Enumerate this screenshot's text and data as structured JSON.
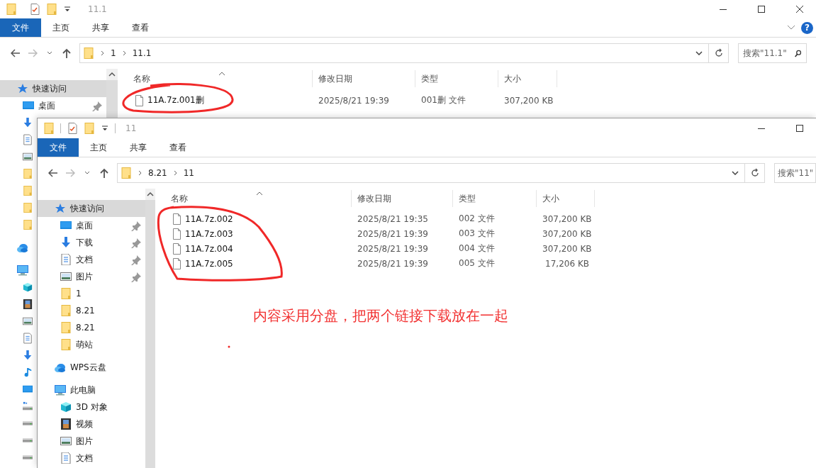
{
  "windows": [
    {
      "title": "11.1",
      "help": "?",
      "tabs": [
        {
          "label": "文件",
          "kind": "file"
        },
        {
          "label": "主页",
          "kind": "tab"
        },
        {
          "label": "共享",
          "kind": "tab"
        },
        {
          "label": "查看",
          "kind": "tab"
        }
      ],
      "path": [
        "1",
        "11.1"
      ],
      "search": {
        "placeholder": "搜索\"11.1\""
      },
      "nav": [
        {
          "label": "快速访问",
          "kind": "star",
          "selected": true,
          "children": [
            {
              "label": "桌面",
              "kind": "desktop",
              "selected": false,
              "pinned": true
            },
            {
              "kind": "download",
              "selected": false,
              "pinned": false
            },
            {
              "kind": "documents",
              "selected": false,
              "pinned": false
            },
            {
              "kind": "pictures",
              "selected": false,
              "pinned": false
            },
            {
              "kind": "folder",
              "selected": false,
              "pinned": false
            },
            {
              "kind": "folder",
              "selected": false,
              "pinned": false
            },
            {
              "kind": "folder",
              "selected": false,
              "pinned": false
            },
            {
              "kind": "folder",
              "selected": false,
              "pinned": false
            }
          ]
        },
        {
          "kind": "cloud",
          "selected": false
        },
        {
          "kind": "pc",
          "selected": false,
          "children": [
            {
              "kind": "cube",
              "selected": false,
              "pinned": false
            },
            {
              "kind": "video",
              "selected": false,
              "pinned": false
            },
            {
              "kind": "pictures",
              "selected": false,
              "pinned": false
            },
            {
              "kind": "documents",
              "selected": false,
              "pinned": false
            },
            {
              "kind": "download",
              "selected": false,
              "pinned": false
            },
            {
              "kind": "music",
              "selected": false,
              "pinned": false
            },
            {
              "kind": "desktop",
              "selected": false,
              "pinned": false
            },
            {
              "kind": "netdrive",
              "selected": false,
              "pinned": false
            },
            {
              "kind": "drive",
              "selected": false,
              "pinned": false
            },
            {
              "kind": "drive",
              "selected": false,
              "pinned": false
            },
            {
              "kind": "drive",
              "selected": false,
              "pinned": false
            }
          ]
        }
      ],
      "columns": [
        "名称",
        "修改日期",
        "类型",
        "大小"
      ],
      "files": [
        {
          "name": "11A.7z.001删",
          "modified": "2025/8/21 19:39",
          "type": "001删 文件",
          "size": "307,200 KB"
        }
      ]
    },
    {
      "title": "11",
      "tabs": [
        {
          "label": "文件",
          "kind": "file"
        },
        {
          "label": "主页",
          "kind": "tab"
        },
        {
          "label": "共享",
          "kind": "tab"
        },
        {
          "label": "查看",
          "kind": "tab"
        }
      ],
      "path": [
        "8.21",
        "11"
      ],
      "search": {
        "placeholder": "搜索\"11\""
      },
      "nav": [
        {
          "label": "快速访问",
          "kind": "star",
          "selected": true,
          "children": [
            {
              "label": "桌面",
              "kind": "desktop",
              "selected": false,
              "pinned": true
            },
            {
              "label": "下载",
              "kind": "download",
              "selected": false,
              "pinned": true
            },
            {
              "label": "文档",
              "kind": "documents",
              "selected": false,
              "pinned": true
            },
            {
              "label": "图片",
              "kind": "pictures",
              "selected": false,
              "pinned": true
            },
            {
              "label": "1",
              "kind": "folder",
              "selected": false,
              "pinned": false
            },
            {
              "label": "8.21",
              "kind": "folder",
              "selected": false,
              "pinned": false
            },
            {
              "label": "8.21",
              "kind": "folder",
              "selected": false,
              "pinned": false
            },
            {
              "label": "萌站",
              "kind": "folder",
              "selected": false,
              "pinned": false
            }
          ]
        },
        {
          "label": "WPS云盘",
          "kind": "cloud",
          "selected": false
        },
        {
          "label": "此电脑",
          "kind": "pc",
          "selected": false,
          "children": [
            {
              "label": "3D 对象",
              "kind": "cube",
              "selected": false,
              "pinned": false
            },
            {
              "label": "视频",
              "kind": "video",
              "selected": false,
              "pinned": false
            },
            {
              "label": "图片",
              "kind": "pictures",
              "selected": false,
              "pinned": false
            },
            {
              "label": "文档",
              "kind": "documents",
              "selected": false,
              "pinned": false
            }
          ]
        }
      ],
      "columns": [
        "名称",
        "修改日期",
        "类型",
        "大小"
      ],
      "files": [
        {
          "name": "11A.7z.002",
          "modified": "2025/8/21 19:35",
          "type": "002 文件",
          "size": "307,200 KB"
        },
        {
          "name": "11A.7z.003",
          "modified": "2025/8/21 19:39",
          "type": "003 文件",
          "size": "307,200 KB"
        },
        {
          "name": "11A.7z.004",
          "modified": "2025/8/21 19:39",
          "type": "004 文件",
          "size": "307,200 KB"
        },
        {
          "name": "11A.7z.005",
          "modified": "2025/8/21 19:39",
          "type": "005 文件",
          "size": "17,206 KB"
        }
      ]
    }
  ],
  "annotation": {
    "note": "内容采用分盘，把两个链接下载放在一起"
  }
}
